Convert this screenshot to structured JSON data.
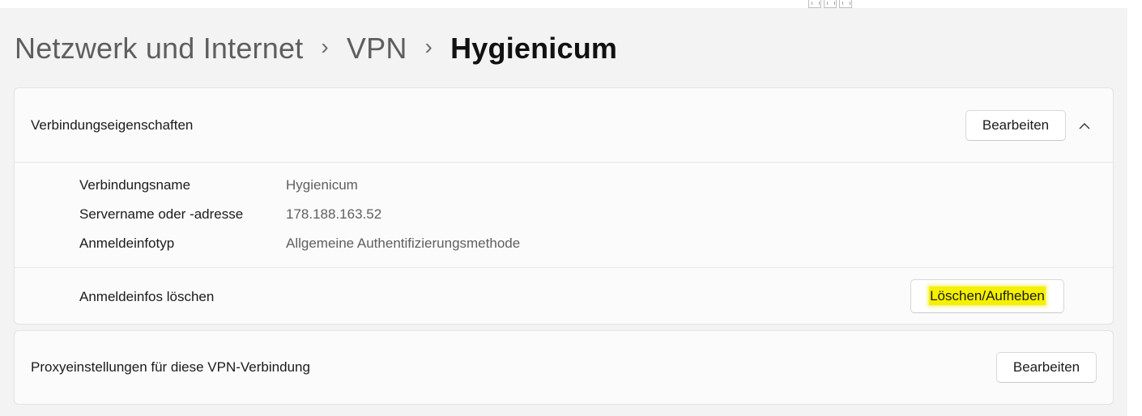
{
  "breadcrumb": {
    "items": [
      "Netzwerk und Internet",
      "VPN",
      "Hygienicum"
    ],
    "separator": "›"
  },
  "connection_properties": {
    "title": "Verbindungseigenschaften",
    "edit_label": "Bearbeiten",
    "rows": [
      {
        "name": "Verbindungsname",
        "value": "Hygienicum"
      },
      {
        "name": "Servername oder -adresse",
        "value": "178.188.163.52"
      },
      {
        "name": "Anmeldeinfotyp",
        "value": "Allgemeine Authentifizierungsmethode"
      }
    ],
    "clear_label": "Anmeldeinfos löschen",
    "clear_button": "Löschen/Aufheben"
  },
  "proxy": {
    "title": "Proxyeinstellungen für diese VPN-Verbindung",
    "edit_label": "Bearbeiten"
  },
  "colors": {
    "highlight": "#f5f000",
    "card": "#fbfbfb",
    "background": "#f3f3f3"
  },
  "icons": {
    "collapse": "chevron-up-icon"
  }
}
